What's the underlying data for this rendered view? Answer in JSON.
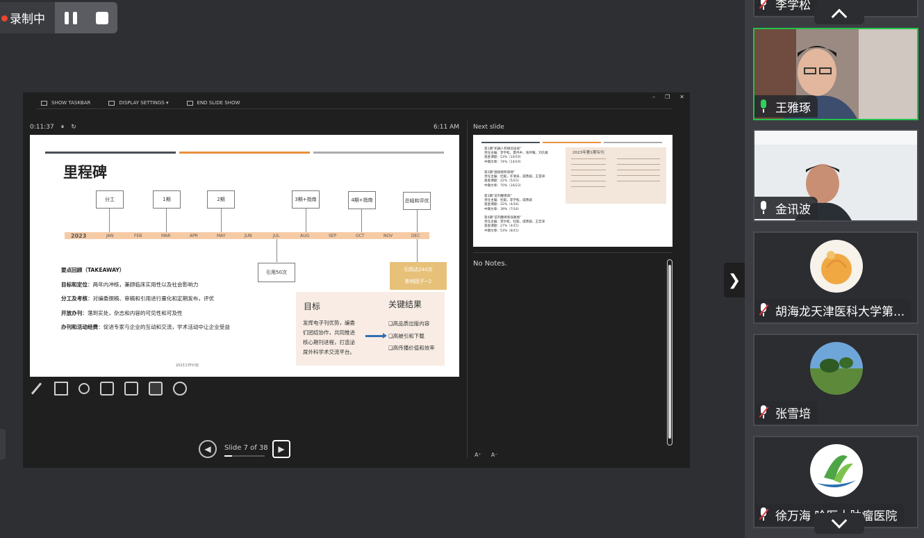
{
  "recording": {
    "label": "录制中"
  },
  "presenter": {
    "toolbar": {
      "show_taskbar": "SHOW TASKBAR",
      "display_settings": "DISPLAY SETTINGS ▾",
      "end_show": "END SLIDE SHOW"
    },
    "elapsed": "0:11:37",
    "clock": "6:11 AM",
    "next_slide_label": "Next slide",
    "notes": "No Notes.",
    "slide_counter": "Slide 7 of 38",
    "progress": 0.184
  },
  "slide": {
    "title": "里程碑",
    "bar_colors": [
      "#4a4f55",
      "#e8903a",
      "#a9abae"
    ],
    "milestones": [
      "分工",
      "1期",
      "2期",
      "3期+指南",
      "4期+指南",
      "总结和评优"
    ],
    "year": "2023",
    "months": [
      "JAN",
      "FEB",
      "MAR",
      "APR",
      "MAY",
      "JUN",
      "JUL",
      "AUG",
      "SEP",
      "OCT",
      "NOV",
      "DEC"
    ],
    "citation_box": "引用50次",
    "gold_box": [
      "引用达240次",
      "影响因子~2"
    ],
    "takeaway_title": "要点回顾（TAKEAWAY）",
    "takeaways": [
      {
        "label": "目标和定位",
        "text": "：两年内冲核，兼顾临床实用性以及社会影响力"
      },
      {
        "label": "分工及考核",
        "text": "：对编委撰稿、审稿和引用进行量化和定期发布，评优"
      },
      {
        "label": "开放办刊",
        "text": "：落到实处，杂志和内容的可见性和可及性"
      },
      {
        "label": "办刊和活动经费",
        "text": "：促进专家与企业的互动和交流，学术活动中让企业受益"
      }
    ],
    "goal_title": "目标",
    "goal_text": [
      "发挥电子刊优势，编委",
      "们团结协作，共同推进",
      "核心期刊进程，打造泌",
      "尿外科学术交流平台。"
    ],
    "result_title": "关键结果",
    "results": [
      "❑高品质出版内容",
      "❑高被引和下载",
      "❑高传播价值和效率"
    ],
    "footer": "2023工作计划"
  },
  "next_slide": {
    "blocks": [
      [
        "第1期“机器人和微创泌尿”",
        "责任主编：李学松，夏丹中，张开耀，刘久敏",
        "基金课题：53%（10/19）",
        "中期文章：74%（14/19）"
      ],
      [
        "第2期“膀胱癌和肾癌”",
        "责任主编：杜毅，许清泉，戚勇骏，王苗祥",
        "基金课题：22%（5/23）",
        "中期文章：70%（16/23）"
      ],
      [
        "第3期“前列腺疾病”",
        "责任主编：杜毅，李学松，戚勇骏",
        "基金课题：22%（4/18）",
        "中期文章：39%（7/18）"
      ],
      [
        "第4期“前列腺癌和尿路癌”",
        "责任主编：李尔松，杜毅，戚勇骏，王忠泽",
        "基金课题：27%（4/15）",
        "中期文章：53%（8/15）"
      ]
    ],
    "card_title": "2023年第1期专刊"
  },
  "participants": [
    {
      "name": "李学松",
      "mic": "muted"
    },
    {
      "name": "王雅琢",
      "mic": "live",
      "active": true
    },
    {
      "name": "金讯波",
      "mic": "on"
    },
    {
      "name": "胡海龙天津医科大学第...",
      "mic": "muted"
    },
    {
      "name": "张雪培",
      "mic": "muted"
    },
    {
      "name": "徐万海 哈医大肿瘤医院",
      "mic": "muted"
    }
  ]
}
